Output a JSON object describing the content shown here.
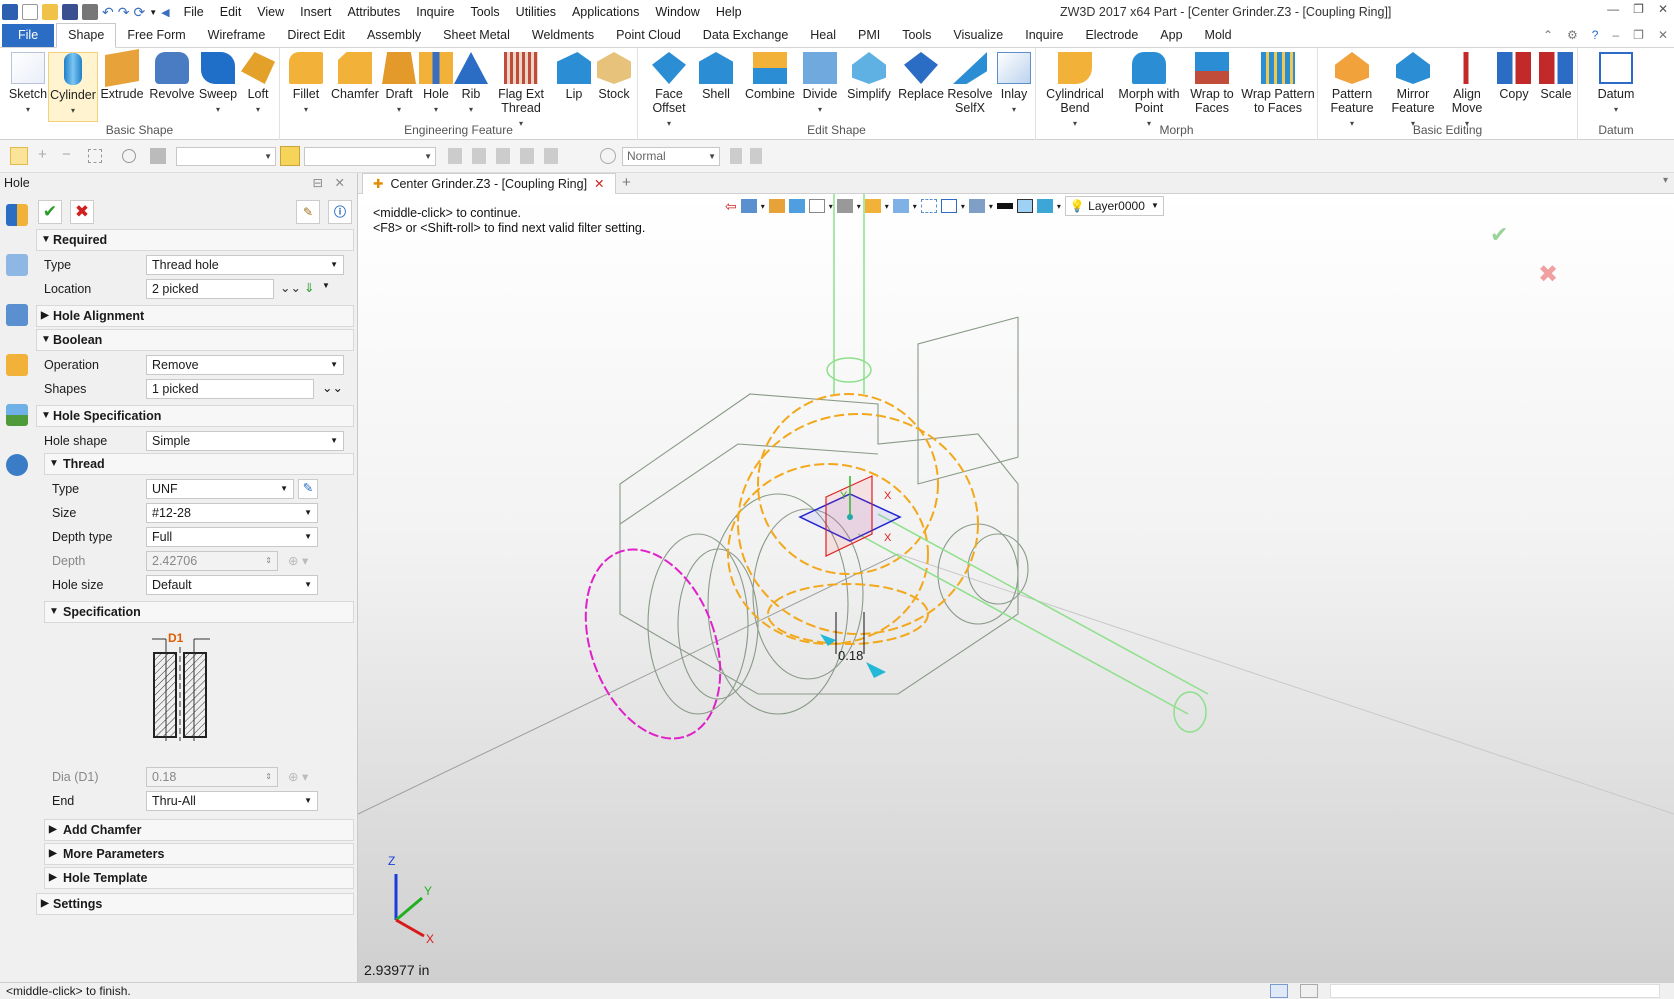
{
  "app": {
    "title": "ZW3D 2017  x64      Part - [Center Grinder.Z3 - [Coupling Ring]]",
    "menu": [
      "File",
      "Edit",
      "View",
      "Insert",
      "Attributes",
      "Inquire",
      "Tools",
      "Utilities",
      "Applications",
      "Window",
      "Help"
    ]
  },
  "ribbon_tabs": [
    "File",
    "Shape",
    "Free Form",
    "Wireframe",
    "Direct Edit",
    "Assembly",
    "Sheet Metal",
    "Weldments",
    "Point Cloud",
    "Data Exchange",
    "Heal",
    "PMI",
    "Tools",
    "Visualize",
    "Inquire",
    "Electrode",
    "App",
    "Mold"
  ],
  "active_tab": "Shape",
  "ribbon": {
    "basic_shape": {
      "label": "Basic Shape",
      "items": [
        "Sketch",
        "Cylinder",
        "Extrude",
        "Revolve",
        "Sweep",
        "Loft"
      ]
    },
    "engineering": {
      "label": "Engineering Feature",
      "items": [
        "Fillet",
        "Chamfer",
        "Draft",
        "Hole",
        "Rib",
        "Flag Ext Thread",
        "Lip",
        "Stock"
      ]
    },
    "edit_shape": {
      "label": "Edit Shape",
      "items": [
        "Face Offset",
        "Shell",
        "Combine",
        "Divide",
        "Simplify",
        "Replace",
        "Resolve SelfX",
        "Inlay"
      ]
    },
    "morph": {
      "label": "Morph",
      "items": [
        "Cylindrical Bend",
        "Morph with Point",
        "Wrap to Faces",
        "Wrap Pattern to Faces"
      ]
    },
    "basic_editing": {
      "label": "Basic Editing",
      "items": [
        "Pattern Feature",
        "Mirror Feature",
        "Align Move",
        "Copy",
        "Scale"
      ]
    },
    "datum": {
      "label": "Datum",
      "items": [
        "Datum"
      ]
    }
  },
  "toolbar2": {
    "render_mode": "Normal"
  },
  "panel": {
    "title": "Hole",
    "required": {
      "label": "Required",
      "type_label": "Type",
      "type_value": "Thread hole",
      "location_label": "Location",
      "location_value": "2 picked"
    },
    "hole_alignment": "Hole Alignment",
    "boolean": {
      "label": "Boolean",
      "operation_label": "Operation",
      "operation_value": "Remove",
      "shapes_label": "Shapes",
      "shapes_value": "1 picked"
    },
    "hole_spec": {
      "label": "Hole Specification",
      "hole_shape_label": "Hole shape",
      "hole_shape_value": "Simple",
      "thread": {
        "label": "Thread",
        "type_label": "Type",
        "type_value": "UNF",
        "size_label": "Size",
        "size_value": "#12-28",
        "depth_type_label": "Depth type",
        "depth_type_value": "Full",
        "depth_label": "Depth",
        "depth_value": "2.42706",
        "hole_size_label": "Hole size",
        "hole_size_value": "Default"
      },
      "specification": {
        "label": "Specification",
        "diagram_label": "D1",
        "dia_label": "Dia (D1)",
        "dia_value": "0.18",
        "end_label": "End",
        "end_value": "Thru-All"
      },
      "add_chamfer": "Add Chamfer",
      "more_params": "More Parameters",
      "hole_template": "Hole Template"
    },
    "settings": "Settings"
  },
  "document_tab": "Center Grinder.Z3 - [Coupling Ring]",
  "viewport": {
    "hint1": "<middle-click> to continue.",
    "hint2": "<F8> or <Shift-roll> to find next valid filter setting.",
    "layer": "Layer0000",
    "dimension": "0.18",
    "measure": "2.93977 in",
    "axes": {
      "x": "X",
      "y": "Y",
      "z": "Z"
    }
  },
  "status": "<middle-click> to finish."
}
